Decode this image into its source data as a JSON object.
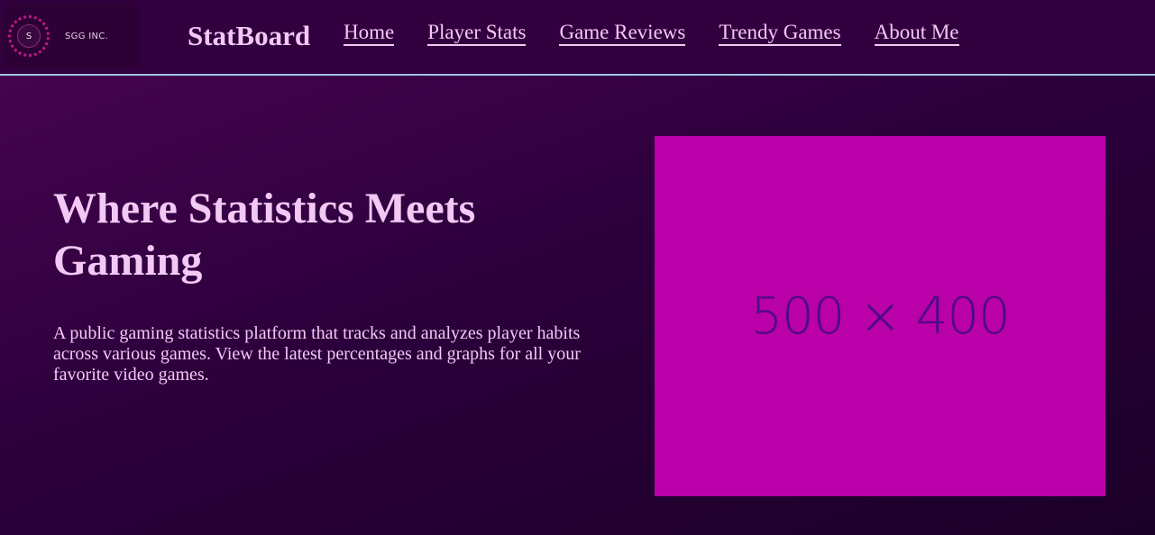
{
  "header": {
    "logo": {
      "letter": "S",
      "company": "SGG INC."
    },
    "brand": "StatBoard",
    "nav": [
      {
        "label": "Home"
      },
      {
        "label": "Player Stats"
      },
      {
        "label": "Game Reviews"
      },
      {
        "label": "Trendy Games"
      },
      {
        "label": "About Me"
      }
    ]
  },
  "hero": {
    "title": "Where Statistics Meets Gaming",
    "description": "A public gaming statistics platform that tracks and analyzes player habits across various games. View the latest percentages and graphs for all your favorite video games.",
    "image_placeholder": "500 × 400"
  },
  "colors": {
    "background": "#33003f",
    "text": "#f2c9f5",
    "placeholder_fill": "#ba00a8",
    "placeholder_text": "#4b0a86",
    "nav_border": "#9ec3e6"
  }
}
